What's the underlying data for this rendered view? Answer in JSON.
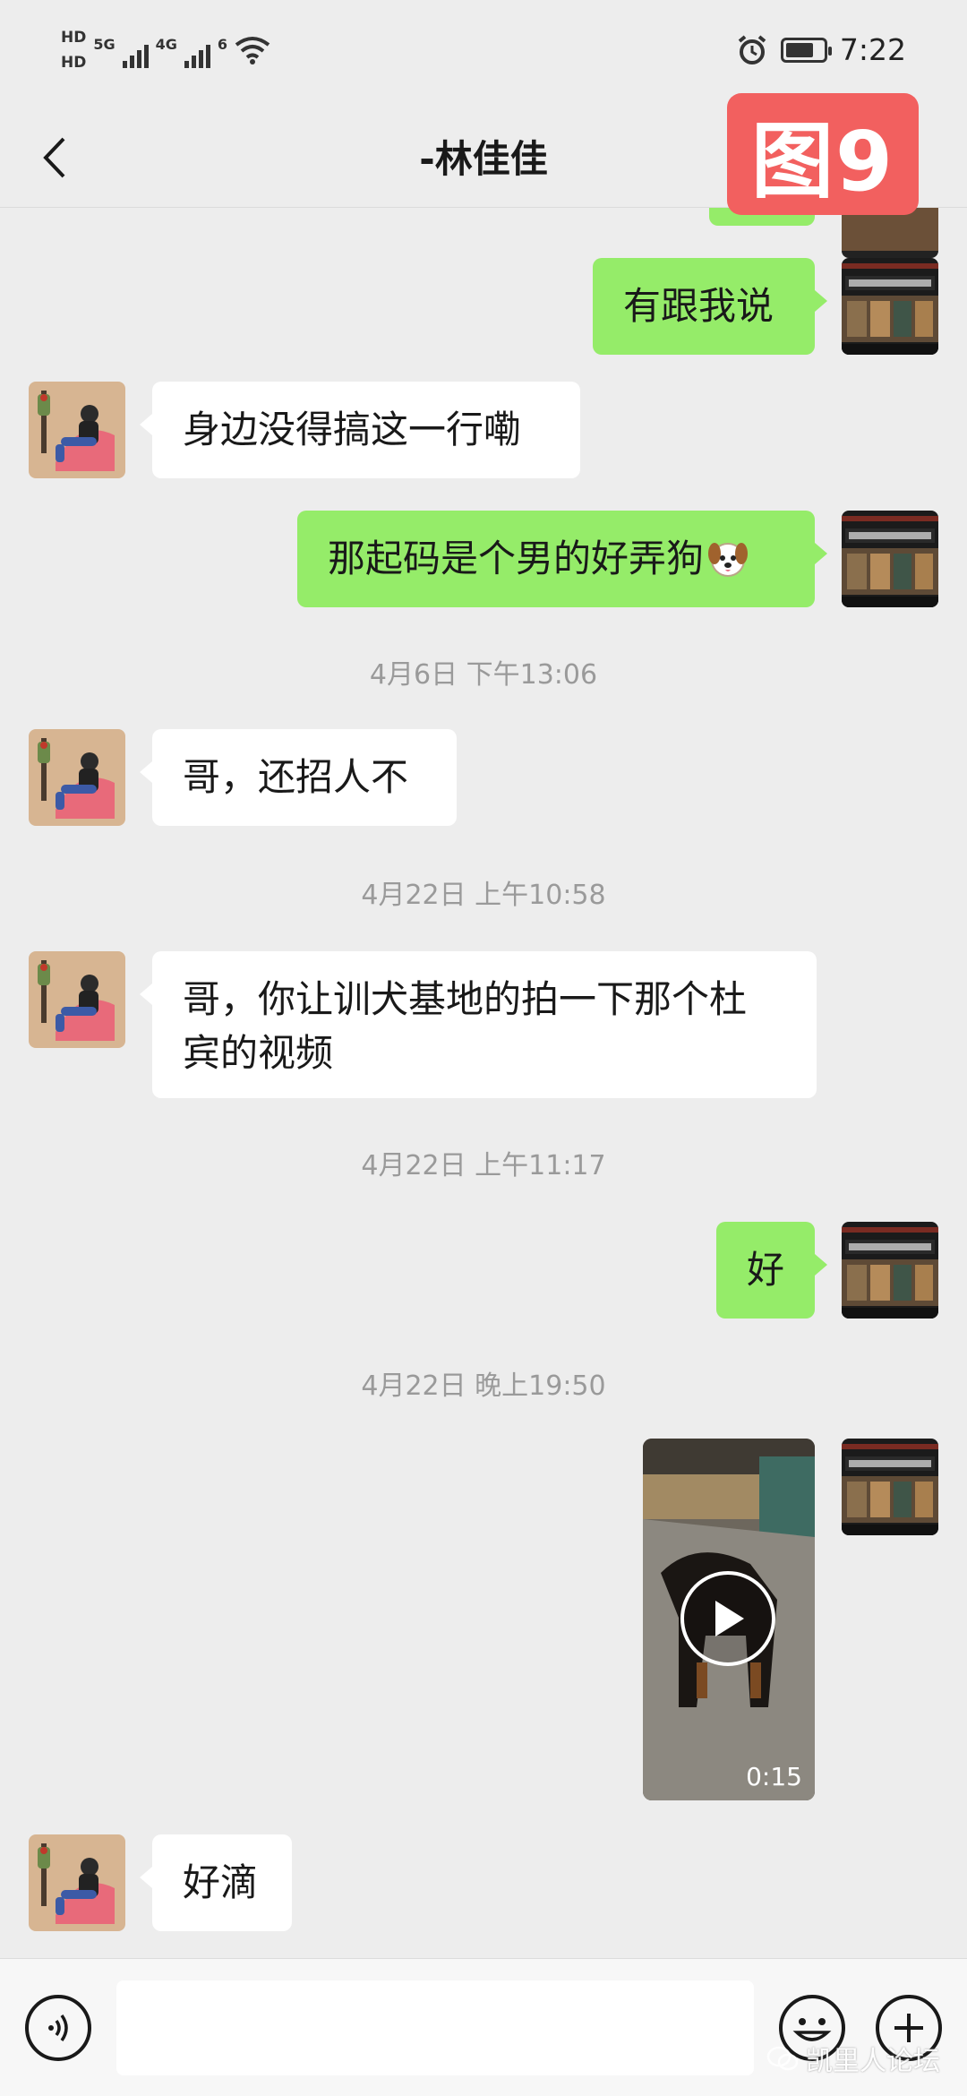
{
  "status_bar": {
    "hd1": "HD",
    "hd2": "HD",
    "net1": "5G",
    "net2": "4G",
    "wifi_label": "6",
    "time": "7:22",
    "battery_level": 0.75
  },
  "nav": {
    "title": "-林佳佳"
  },
  "tag": "图9",
  "messages": {
    "m0": {
      "side": "out",
      "text": "有跟我说"
    },
    "m1": {
      "side": "in",
      "text": "身边没得搞这一行嘞"
    },
    "m2": {
      "side": "out",
      "text": "那起码是个男的好弄狗"
    },
    "t1": "4月6日 下午13:06",
    "m3": {
      "side": "in",
      "text": "哥，还招人不"
    },
    "t2": "4月22日 上午10:58",
    "m4": {
      "side": "in",
      "text_line1": "哥，你让训犬基地的拍一下那个杜",
      "text_line2": "宾的视频"
    },
    "t3": "4月22日 上午11:17",
    "m5": {
      "side": "out",
      "text": "好"
    },
    "t4": "4月22日 晚上19:50",
    "video": {
      "duration": "0:15"
    },
    "m6": {
      "side": "in",
      "text": "好滴"
    }
  },
  "input": {
    "placeholder": ""
  },
  "watermark": "凯里人论坛",
  "colors": {
    "background": "#ededed",
    "outgoing_bubble": "#95ec69",
    "incoming_bubble": "#ffffff",
    "tag": "#f2605f"
  }
}
